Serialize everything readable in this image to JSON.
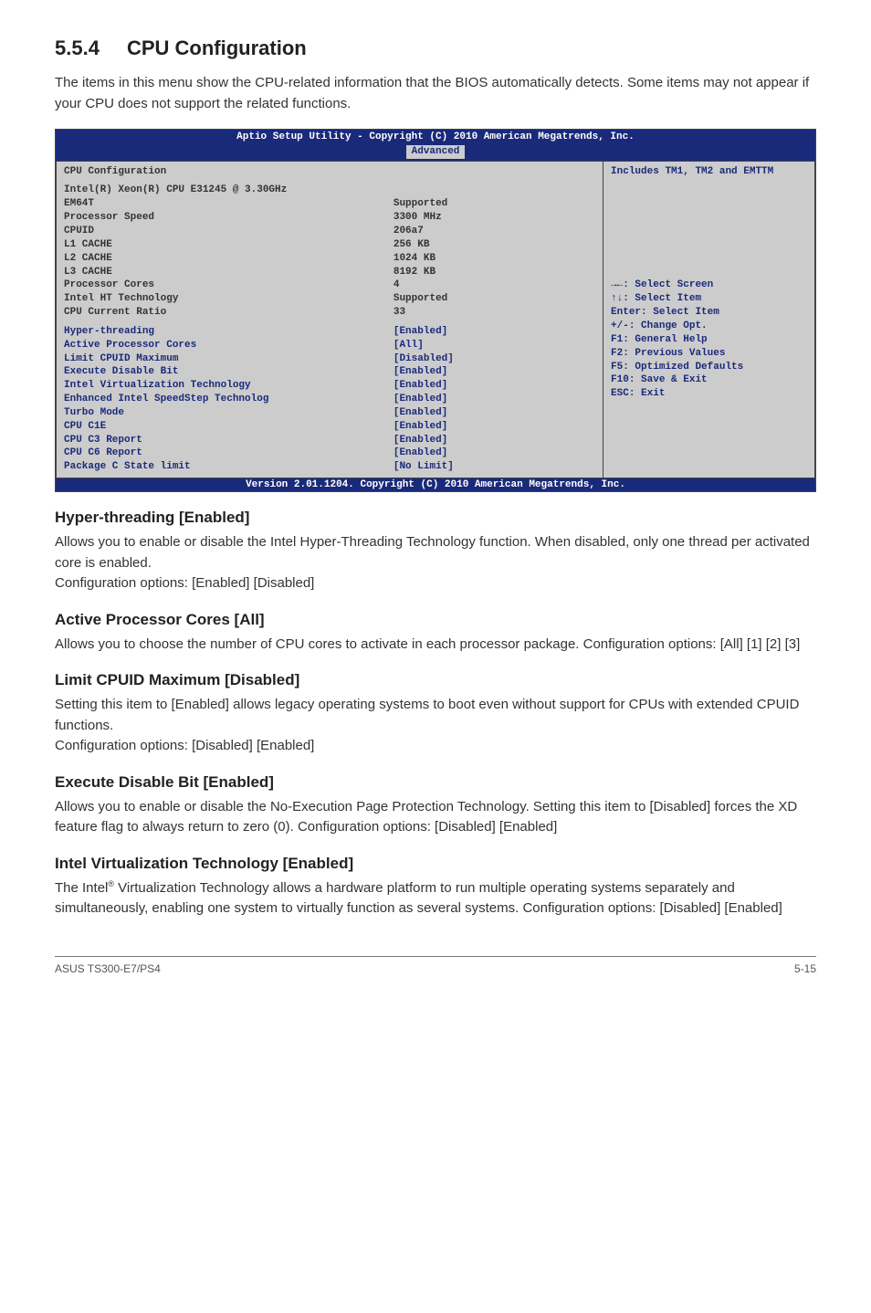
{
  "section": {
    "number": "5.5.4",
    "title": "CPU Configuration",
    "intro": "The items in this menu show the CPU-related information that the BIOS automatically detects. Some items may not appear if your CPU does not support the related functions."
  },
  "bios": {
    "header_line": "Aptio Setup Utility - Copyright (C) 2010 American Megatrends, Inc.",
    "tab_label": "Advanced",
    "panel_title": "CPU Configuration",
    "info_rows": [
      {
        "label": "Intel(R) Xeon(R) CPU E31245 @ 3.30GHz",
        "value": ""
      },
      {
        "label": "EM64T",
        "value": "Supported"
      },
      {
        "label": "Processor Speed",
        "value": "3300 MHz"
      },
      {
        "label": "CPUID",
        "value": "206a7"
      },
      {
        "label": "L1 CACHE",
        "value": "256 KB"
      },
      {
        "label": "L2 CACHE",
        "value": "1024 KB"
      },
      {
        "label": "L3 CACHE",
        "value": "8192 KB"
      },
      {
        "label": "Processor Cores",
        "value": "4"
      },
      {
        "label": "Intel HT Technology",
        "value": "Supported"
      },
      {
        "label": "CPU Current Ratio",
        "value": "33"
      }
    ],
    "option_rows": [
      {
        "label": "Hyper-threading",
        "value": "[Enabled]"
      },
      {
        "label": "Active Processor Cores",
        "value": "[All]"
      },
      {
        "label": "Limit CPUID Maximum",
        "value": "[Disabled]"
      },
      {
        "label": "Execute Disable Bit",
        "value": "[Enabled]"
      },
      {
        "label": "Intel Virtualization Technology",
        "value": "[Enabled]"
      },
      {
        "label": "Enhanced Intel SpeedStep Technolog",
        "value": "[Enabled]"
      },
      {
        "label": "Turbo Mode",
        "value": "[Enabled]"
      },
      {
        "label": "CPU C1E",
        "value": "[Enabled]"
      },
      {
        "label": "CPU C3 Report",
        "value": "[Enabled]"
      },
      {
        "label": "CPU C6 Report",
        "value": "[Enabled]"
      },
      {
        "label": "Package C State limit",
        "value": "[No Limit]"
      }
    ],
    "help_top": "Includes TM1, TM2 and EMTTM",
    "help_nav": [
      "→←: Select Screen",
      "↑↓:  Select Item",
      "Enter: Select Item",
      "+/-: Change Opt.",
      "F1: General Help",
      "F2: Previous Values",
      "F5: Optimized Defaults",
      "F10: Save & Exit",
      "ESC: Exit"
    ],
    "footer_line": "Version 2.01.1204. Copyright (C) 2010 American Megatrends, Inc."
  },
  "options": [
    {
      "heading": "Hyper-threading [Enabled]",
      "desc": "Allows you to enable or disable the Intel Hyper-Threading Technology function. When disabled, only one thread per activated core is enabled.\nConfiguration options: [Enabled] [Disabled]"
    },
    {
      "heading": "Active Processor Cores [All]",
      "desc": "Allows you to choose the number of CPU cores to activate in each processor package. Configuration options: [All] [1] [2] [3]"
    },
    {
      "heading": "Limit CPUID Maximum [Disabled]",
      "desc": "Setting this item to [Enabled] allows legacy operating systems to boot even without support for CPUs with extended CPUID functions.\nConfiguration options: [Disabled] [Enabled]"
    },
    {
      "heading": "Execute Disable Bit [Enabled]",
      "desc": "Allows you to enable or disable the No-Execution Page Protection Technology. Setting this item to [Disabled] forces the XD feature flag to always return to zero (0). Configuration options: [Disabled] [Enabled]"
    },
    {
      "heading": "Intel Virtualization Technology [Enabled]",
      "desc_html": "The Intel<span class=\"sup\">®</span> Virtualization Technology allows a hardware platform to run multiple operating systems separately and simultaneously, enabling one system to virtually function as several systems. Configuration options: [Disabled] [Enabled]"
    }
  ],
  "footer": {
    "left": "ASUS TS300-E7/PS4",
    "right": "5-15"
  }
}
